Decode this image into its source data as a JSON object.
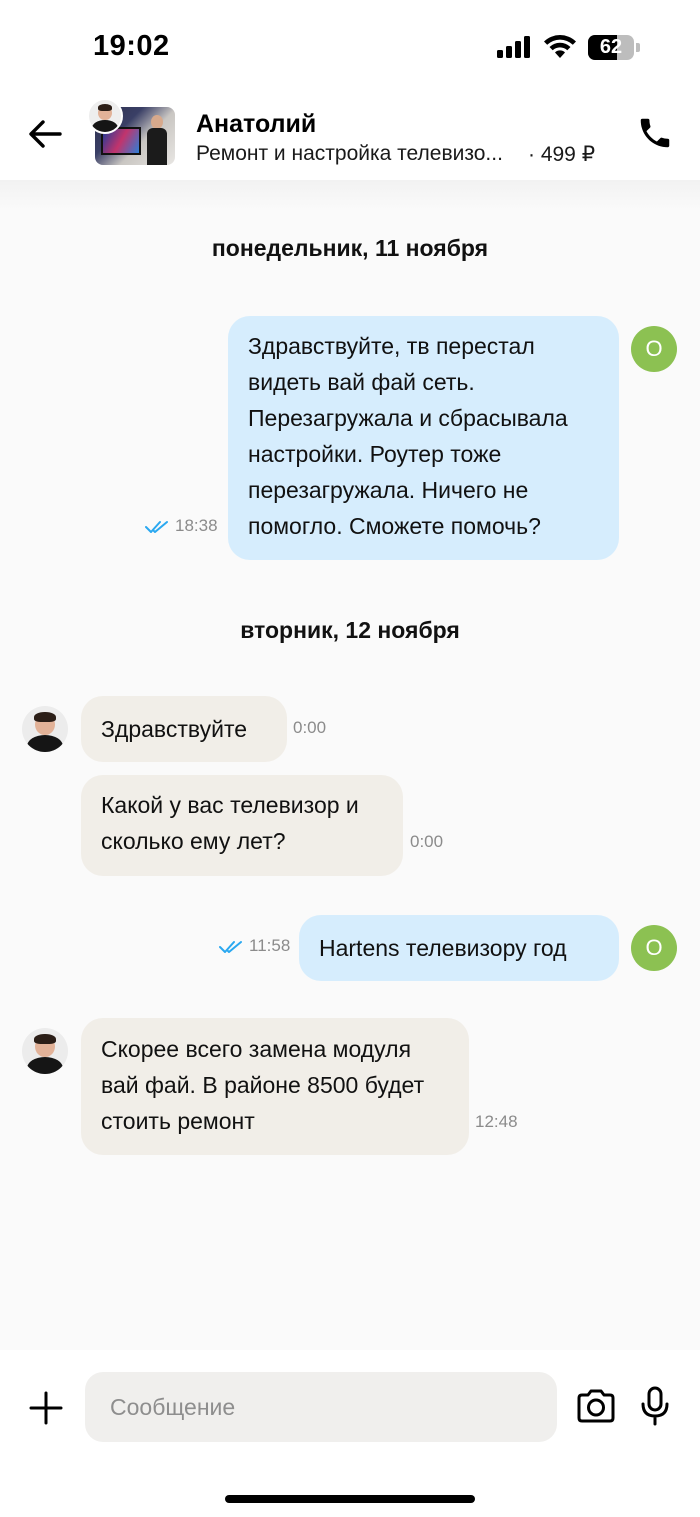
{
  "status_bar": {
    "time": "19:02",
    "battery_percent": "62",
    "battery_level": 0.62,
    "icons": [
      "signal-icon",
      "wifi-icon",
      "battery-icon"
    ]
  },
  "header": {
    "name": "Анатолий",
    "listing_title": "Ремонт и настройка телевизо...",
    "price": "· 499 ₽",
    "icons": [
      "back-arrow-icon",
      "phone-icon"
    ]
  },
  "chat": {
    "days": [
      {
        "label": "понедельник, 11 ноября"
      },
      {
        "label": "вторник, 12 ноября"
      }
    ],
    "messages": [
      {
        "direction": "out",
        "lines": [
          "Здравствуйте, тв перестал",
          "видеть вай фай сеть.",
          "Перезагружала и сбрасывала",
          "настройки. Роутер тоже",
          "перезагружала. Ничего не",
          "помогло. Сможете помочь?"
        ],
        "time": "18:38",
        "read": true,
        "avatar_letter": "О"
      },
      {
        "direction": "in",
        "lines": [
          "Здравствуйте"
        ],
        "time": "0:00"
      },
      {
        "direction": "in",
        "lines": [
          "Какой у вас телевизор и",
          "сколько ему лет?"
        ],
        "time": "0:00"
      },
      {
        "direction": "out",
        "lines": [
          "Hartens телевизору год"
        ],
        "time": "11:58",
        "read": true,
        "avatar_letter": "О"
      },
      {
        "direction": "in",
        "lines": [
          "Скорее всего замена модуля",
          "вай фай. В районе 8500 будет",
          "стоить ремонт"
        ],
        "time": "12:48"
      }
    ]
  },
  "composer": {
    "placeholder": "Сообщение",
    "icons": [
      "plus-icon",
      "camera-icon",
      "microphone-icon"
    ]
  },
  "colors": {
    "outgoing_bubble": "#d6edfd",
    "incoming_bubble": "#f1eee8",
    "user_avatar": "#8cc152",
    "read_ticks": "#2aa8f0"
  }
}
